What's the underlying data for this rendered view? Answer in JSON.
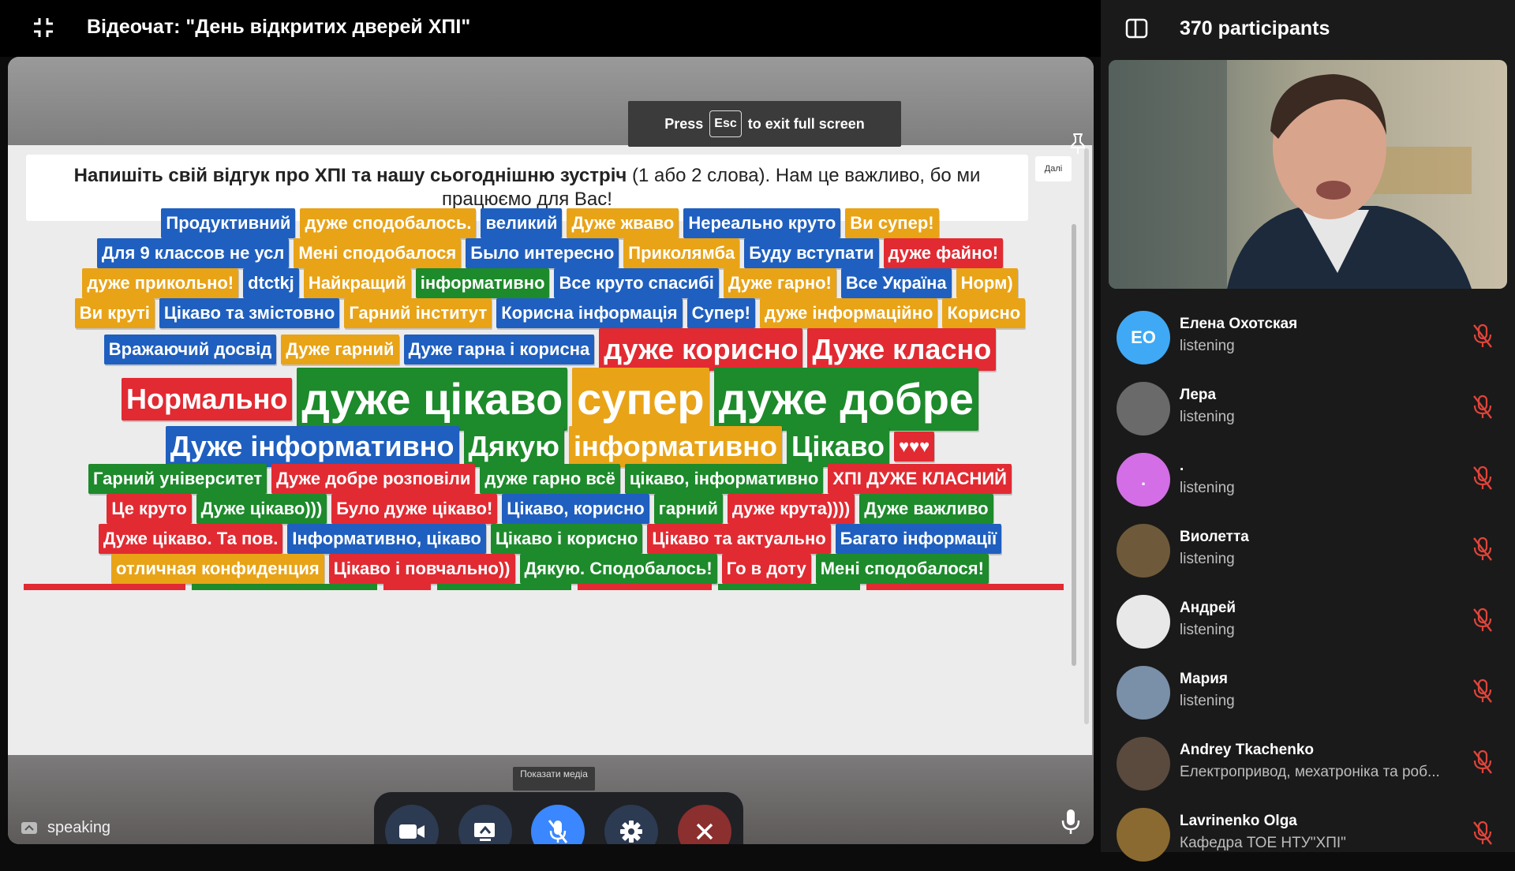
{
  "window": {
    "title": "Відеочат: \"День відкритих дверей ХПІ\"",
    "esc_hint": {
      "before": "Press",
      "key": "Esc",
      "after": "to exit full screen"
    }
  },
  "slide": {
    "question_bold": "Напишіть свій відгук про ХПІ та нашу сьогоднішню зустріч",
    "question_rest": "(1 або 2 слова). Нам це важливо, бо ми працюємо для Вас!",
    "next_label": "Далі",
    "word_rows": [
      [
        {
          "t": "Продуктивний",
          "c": "blue",
          "s": 1
        },
        {
          "t": "дуже сподобалось.",
          "c": "orange",
          "s": 1
        },
        {
          "t": "великий",
          "c": "blue",
          "s": 1
        },
        {
          "t": "Дуже жваво",
          "c": "orange",
          "s": 1
        },
        {
          "t": "Нереально круто",
          "c": "blue",
          "s": 1
        },
        {
          "t": "Ви супер!",
          "c": "orange",
          "s": 1
        }
      ],
      [
        {
          "t": "Для 9 классов не усл",
          "c": "blue",
          "s": 1
        },
        {
          "t": "Мені сподобалося",
          "c": "orange",
          "s": 1
        },
        {
          "t": "Было интересно",
          "c": "blue",
          "s": 1
        },
        {
          "t": "Приколямба",
          "c": "orange",
          "s": 1
        },
        {
          "t": "Буду вступати",
          "c": "blue",
          "s": 1
        },
        {
          "t": "дуже файно!",
          "c": "red",
          "s": 1
        }
      ],
      [
        {
          "t": "дуже прикольно!",
          "c": "orange",
          "s": 1
        },
        {
          "t": "dtctkj",
          "c": "blue",
          "s": 1
        },
        {
          "t": "Найкращий",
          "c": "orange",
          "s": 1
        },
        {
          "t": "інформативно",
          "c": "green",
          "s": 1
        },
        {
          "t": "Все круто спасибі",
          "c": "blue",
          "s": 1
        },
        {
          "t": "Дуже гарно!",
          "c": "orange",
          "s": 1
        },
        {
          "t": "Все Україна",
          "c": "blue",
          "s": 1
        },
        {
          "t": "Норм)",
          "c": "orange",
          "s": 1
        }
      ],
      [
        {
          "t": "Ви круті",
          "c": "orange",
          "s": 1
        },
        {
          "t": "Цікаво та змістовно",
          "c": "blue",
          "s": 1
        },
        {
          "t": "Гарний інститут",
          "c": "orange",
          "s": 1
        },
        {
          "t": "Корисна інформація",
          "c": "blue",
          "s": 1
        },
        {
          "t": "Супер!",
          "c": "blue",
          "s": 1
        },
        {
          "t": "дуже інформаційно",
          "c": "orange",
          "s": 1
        },
        {
          "t": "Корисно",
          "c": "orange",
          "s": 1
        }
      ],
      [
        {
          "t": "Вражаючий досвід",
          "c": "blue",
          "s": 1
        },
        {
          "t": "Дуже гарний",
          "c": "orange",
          "s": 1
        },
        {
          "t": "Дуже гарна і корисна",
          "c": "blue",
          "s": 1
        },
        {
          "t": "дуже корисно",
          "c": "red",
          "s": 2
        },
        {
          "t": "Дуже класно",
          "c": "red",
          "s": 2
        }
      ],
      [
        {
          "t": "Нормально",
          "c": "red",
          "s": 2
        },
        {
          "t": "дуже цікаво",
          "c": "green",
          "s": 3
        },
        {
          "t": "супер",
          "c": "orange",
          "s": 3
        },
        {
          "t": "дуже добре",
          "c": "green",
          "s": 3
        }
      ],
      [
        {
          "t": "Дуже інформативно",
          "c": "blue",
          "s": 4
        },
        {
          "t": "Дякую",
          "c": "green",
          "s": 4
        },
        {
          "t": "інформативно",
          "c": "orange",
          "s": 4
        },
        {
          "t": "Цікаво",
          "c": "green",
          "s": 4
        },
        {
          "t": "♥♥♥",
          "c": "red",
          "s": 1
        }
      ],
      [
        {
          "t": "Гарний університет",
          "c": "green",
          "s": 1
        },
        {
          "t": "Дуже добре розповіли",
          "c": "red",
          "s": 1
        },
        {
          "t": "дуже гарно всё",
          "c": "green",
          "s": 1
        },
        {
          "t": "цікаво, інформативно",
          "c": "green",
          "s": 1
        },
        {
          "t": "ХПІ ДУЖЕ КЛАСНИЙ",
          "c": "red",
          "s": 1
        }
      ],
      [
        {
          "t": "Це круто",
          "c": "red",
          "s": 1
        },
        {
          "t": "Дуже цікаво)))",
          "c": "green",
          "s": 1
        },
        {
          "t": "Було дуже цікаво!",
          "c": "red",
          "s": 1
        },
        {
          "t": "Цікаво, корисно",
          "c": "blue",
          "s": 1
        },
        {
          "t": "гарний",
          "c": "green",
          "s": 1
        },
        {
          "t": "дуже крута))))",
          "c": "red",
          "s": 1
        },
        {
          "t": "Дуже важливо",
          "c": "green",
          "s": 1
        }
      ],
      [
        {
          "t": "Дуже цікаво. Та пов.",
          "c": "red",
          "s": 1
        },
        {
          "t": "Інформативно, цікаво",
          "c": "blue",
          "s": 1
        },
        {
          "t": "Цікаво і корисно",
          "c": "green",
          "s": 1
        },
        {
          "t": "Цікаво та актуально",
          "c": "red",
          "s": 1
        },
        {
          "t": "Багато інформації",
          "c": "blue",
          "s": 1
        }
      ],
      [
        {
          "t": "отличная конфиденция",
          "c": "orange",
          "s": 1
        },
        {
          "t": "Цікаво і повчально))",
          "c": "red",
          "s": 1
        },
        {
          "t": "Дякую. Сподобалось!",
          "c": "green",
          "s": 1
        },
        {
          "t": "Го в доту",
          "c": "red",
          "s": 1
        },
        {
          "t": "Мені сподобалося!",
          "c": "green",
          "s": 1
        }
      ]
    ]
  },
  "controls": {
    "media_tooltip": "Показати медіа",
    "camera_icon": "camera-icon",
    "share_icon": "screen-share-icon",
    "mic_icon": "mic-off-icon",
    "settings_icon": "gear-icon",
    "leave_icon": "close-icon"
  },
  "status": {
    "speaking_label": "speaking"
  },
  "panel": {
    "participants_count": "370 participants",
    "participants": [
      {
        "name": "Елена Охотская",
        "status": "listening",
        "initials": "ЕО",
        "avatar_color": "#3fa9f5"
      },
      {
        "name": "Лера",
        "status": "listening",
        "initials": "",
        "avatar_color": "#6a6a6a"
      },
      {
        "name": ".",
        "status": "listening",
        "initials": ".",
        "avatar_color": "#d36ee6"
      },
      {
        "name": "Виолетта",
        "status": "listening",
        "initials": "",
        "avatar_color": "#6e5a3a"
      },
      {
        "name": "Андрей",
        "status": "listening",
        "initials": "",
        "avatar_color": "#e8e8e8"
      },
      {
        "name": "Мария",
        "status": "listening",
        "initials": "",
        "avatar_color": "#7a8fa8"
      },
      {
        "name": "Andrey Tkachenko",
        "status": "Електропривод, мехатроніка та роб...",
        "initials": "",
        "avatar_color": "#5a4a3e"
      },
      {
        "name": "Lavrinenko Olga",
        "status": "Кафедра ТОЕ НТУ\"ХПІ\"",
        "initials": "",
        "avatar_color": "#8a6a30"
      }
    ]
  },
  "colors": {
    "blue": "#1f5fbf",
    "orange": "#e8a317",
    "red": "#e22a32",
    "green": "#1d8a2b",
    "mic_active": "#3a87ff",
    "leave": "#8b2f2f",
    "muted_icon": "#e0443a"
  }
}
